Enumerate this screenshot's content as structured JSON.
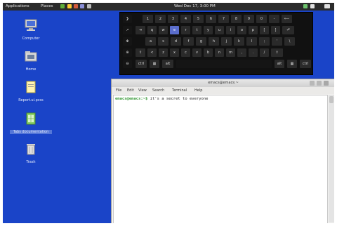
{
  "top_panel": {
    "menus": [
      "Applications",
      "Places"
    ],
    "clock": "Wed Dec 17, 3:00 PM"
  },
  "desktop_icons": [
    {
      "label": "Computer",
      "icon": "computer-icon"
    },
    {
      "label": "Home",
      "icon": "folder-icon"
    },
    {
      "label": "Report.ui.pcss",
      "icon": "document-icon"
    },
    {
      "label": "Tabs documentation",
      "icon": "spreadsheet-icon",
      "selected": true
    },
    {
      "label": "Trash",
      "icon": "trash-icon"
    }
  ],
  "keyboard": {
    "row1": [
      "1",
      "2",
      "3",
      "4",
      "5",
      "6",
      "7",
      "8",
      "9",
      "0",
      "-",
      "⟵"
    ],
    "row2": [
      "⇥",
      "q",
      "w",
      "e",
      "r",
      "t",
      "y",
      "u",
      "i",
      "o",
      "p",
      "[",
      "]",
      "⮐"
    ],
    "row3": [
      "a",
      "s",
      "d",
      "f",
      "g",
      "h",
      "j",
      "k",
      "l",
      ";",
      "'",
      "\\"
    ],
    "row4": [
      "⇧",
      "<",
      "z",
      "x",
      "c",
      "v",
      "b",
      "n",
      "m",
      ",",
      ".",
      "/",
      "⇧"
    ],
    "row5": {
      "ctrl_left": "ctrl",
      "alt_left": "alt",
      "alt_right": "alt",
      "ctrl_right": "ctrl"
    },
    "side_glyphs": [
      "❯",
      "↗",
      "✥",
      "⊕",
      "⊖"
    ],
    "active_key": "e"
  },
  "terminal": {
    "title": "emacs@emacs:~",
    "menu": [
      "File",
      "Edit",
      "View",
      "Search",
      "Terminal",
      "Help"
    ],
    "prompt": "emacs@emacs:~$",
    "command": "it's a secret to everyone"
  },
  "colors": {
    "desktop": "#1a44c8",
    "panel": "#2b2b2b",
    "active_key": "#5a6dcc",
    "prompt": "#3a9a3a"
  }
}
